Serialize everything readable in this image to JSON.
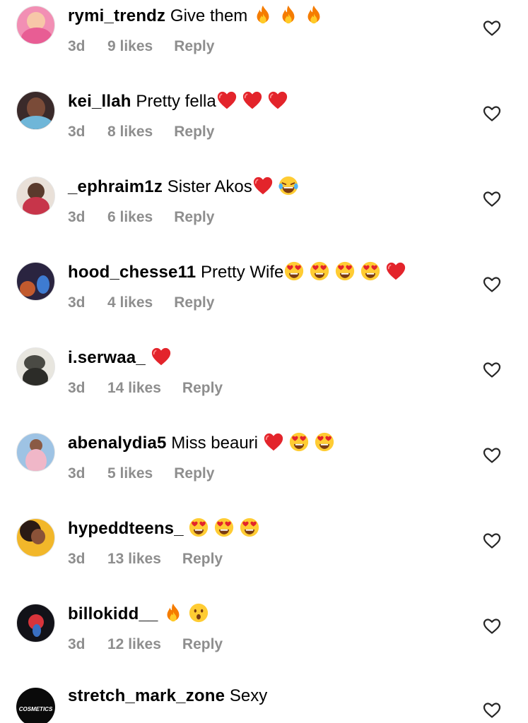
{
  "comments": [
    {
      "username": "rymi_trendz",
      "message": "Give them",
      "emojis": [
        "fire",
        "fire",
        "fire"
      ],
      "time": "3d",
      "likes": "9 likes",
      "reply": "Reply",
      "avatar_color": "#f28fb4"
    },
    {
      "username": "kei_llah",
      "message": "Pretty fella",
      "emojis": [
        "red-heart",
        "red-heart",
        "red-heart"
      ],
      "time": "3d",
      "likes": "8 likes",
      "reply": "Reply",
      "avatar_color": "#3a2a2a"
    },
    {
      "username": "_ephraim1z",
      "message": "Sister Akos",
      "emojis": [
        "red-heart",
        "tears-of-joy"
      ],
      "time": "3d",
      "likes": "6 likes",
      "reply": "Reply",
      "avatar_color": "#c7354a"
    },
    {
      "username": "hood_chesse11",
      "message": "Pretty Wife",
      "emojis": [
        "heart-eyes",
        "heart-eyes",
        "heart-eyes",
        "heart-eyes",
        "red-heart"
      ],
      "time": "3d",
      "likes": "4 likes",
      "reply": "Reply",
      "avatar_color": "#2a2440"
    },
    {
      "username": "i.serwaa_",
      "message": "",
      "emojis": [
        "red-heart"
      ],
      "time": "3d",
      "likes": "14 likes",
      "reply": "Reply",
      "avatar_color": "#4a4a44"
    },
    {
      "username": "abenalydia5",
      "message": "Miss beauri",
      "emojis": [
        "red-heart",
        "heart-eyes",
        "heart-eyes"
      ],
      "time": "3d",
      "likes": "5 likes",
      "reply": "Reply",
      "avatar_color": "#9ec3e4"
    },
    {
      "username": "hypeddteens_",
      "message": "",
      "emojis": [
        "heart-eyes",
        "heart-eyes",
        "heart-eyes"
      ],
      "time": "3d",
      "likes": "13 likes",
      "reply": "Reply",
      "avatar_color": "#f2b72a"
    },
    {
      "username": "billokidd__",
      "message": "",
      "emojis": [
        "fire",
        "surprised"
      ],
      "time": "3d",
      "likes": "12 likes",
      "reply": "Reply",
      "avatar_color": "#121218"
    },
    {
      "username": "stretch_mark_zone",
      "message": "Sexy",
      "emojis": [],
      "time": "",
      "likes": "",
      "reply": "",
      "avatar_color": "#0a0a0a",
      "avatar_text": "COSMETICS"
    }
  ],
  "colors": {
    "meta_text": "#8e8e8e",
    "heart_outline": "#262626"
  }
}
